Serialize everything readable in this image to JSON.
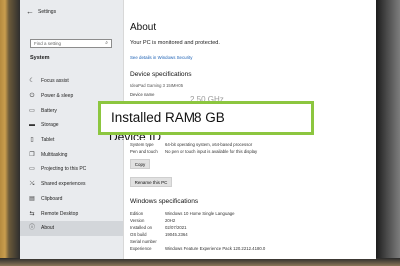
{
  "window": {
    "title": "Settings"
  },
  "sidebar": {
    "search_placeholder": "Find a setting",
    "section": "System",
    "items": [
      {
        "label": "Focus assist",
        "icon": "moon-icon",
        "glyph": "☾"
      },
      {
        "label": "Power & sleep",
        "icon": "power-icon",
        "glyph": "⏻"
      },
      {
        "label": "Battery",
        "icon": "battery-icon",
        "glyph": "▭"
      },
      {
        "label": "Storage",
        "icon": "storage-icon",
        "glyph": "▬"
      },
      {
        "label": "Tablet",
        "icon": "tablet-icon",
        "glyph": "▯"
      },
      {
        "label": "Multitasking",
        "icon": "multitasking-icon",
        "glyph": "❐"
      },
      {
        "label": "Projecting to this PC",
        "icon": "projector-icon",
        "glyph": "▭"
      },
      {
        "label": "Shared experiences",
        "icon": "shared-icon",
        "glyph": "⤯"
      },
      {
        "label": "Clipboard",
        "icon": "clipboard-icon",
        "glyph": "▤"
      },
      {
        "label": "Remote Desktop",
        "icon": "remote-icon",
        "glyph": "⇆"
      },
      {
        "label": "About",
        "icon": "info-icon",
        "glyph": "ⓘ"
      }
    ],
    "selected_index": 10
  },
  "main": {
    "title": "About",
    "protection_text": "Your PC is monitored and protected.",
    "security_link": "See details in Windows Security",
    "device_specs_heading": "Device specifications",
    "device_name_value": "IdeaPad Gaming 3 15IMH05",
    "device_name_label": "Device name",
    "specs": [
      {
        "key": "System type",
        "value": "64-bit operating system, x64-based processor"
      },
      {
        "key": "Pen and touch",
        "value": "No pen or touch input is available for this display"
      }
    ],
    "copy_button": "Copy",
    "rename_button": "Rename this PC",
    "windows_specs_heading": "Windows specifications",
    "windows_specs": [
      {
        "key": "Edition",
        "value": "Windows 10 Home Single Language"
      },
      {
        "key": "Version",
        "value": "20H2"
      },
      {
        "key": "Installed on",
        "value": "02/07/2021"
      },
      {
        "key": "OS build",
        "value": "19045.2364"
      },
      {
        "key": "Serial number",
        "value": ""
      },
      {
        "key": "Experience",
        "value": "Windows Feature Experience Pack 120.2212.4180.0"
      }
    ]
  },
  "callout": {
    "label": "Installed RAM",
    "value": "8 GB",
    "behind_top": "2.50 GHz",
    "behind_bottom": "Device ID"
  },
  "colors": {
    "highlight_border": "#8cc63f",
    "link": "#1a5fb4"
  }
}
